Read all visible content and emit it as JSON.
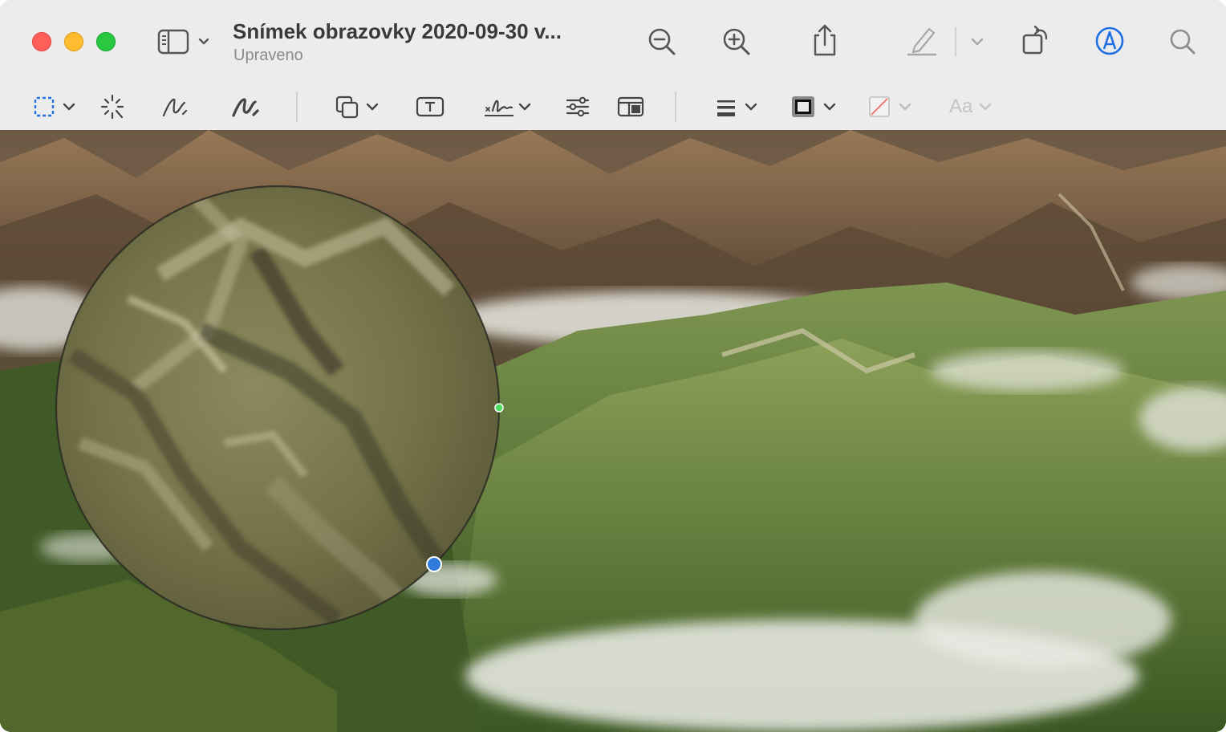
{
  "window": {
    "title": "Snímek obrazovky 2020-09-30 v...",
    "subtitle": "Upraveno",
    "traffic_lights": [
      "close",
      "minimize",
      "zoom"
    ]
  },
  "toolbar": {
    "icons": [
      "sidebar-icon",
      "zoom-out-icon",
      "zoom-in-icon",
      "share-icon",
      "highlight-pen-icon",
      "rotate-icon",
      "markup-icon",
      "search-icon"
    ]
  },
  "markup_toolbar": {
    "icons": [
      "selection-icon",
      "instant-alpha-icon",
      "sketch-icon",
      "draw-icon",
      "shapes-icon",
      "text-box-icon",
      "signature-icon",
      "adjust-color-icon",
      "page-layout-icon",
      "line-style-icon",
      "border-color-icon",
      "fill-color-icon"
    ],
    "font_button_label": "Aa"
  },
  "colors": {
    "accent": "#1f6fe5",
    "handle_green": "#4cd964",
    "handle_blue": "#2f7bdc"
  }
}
